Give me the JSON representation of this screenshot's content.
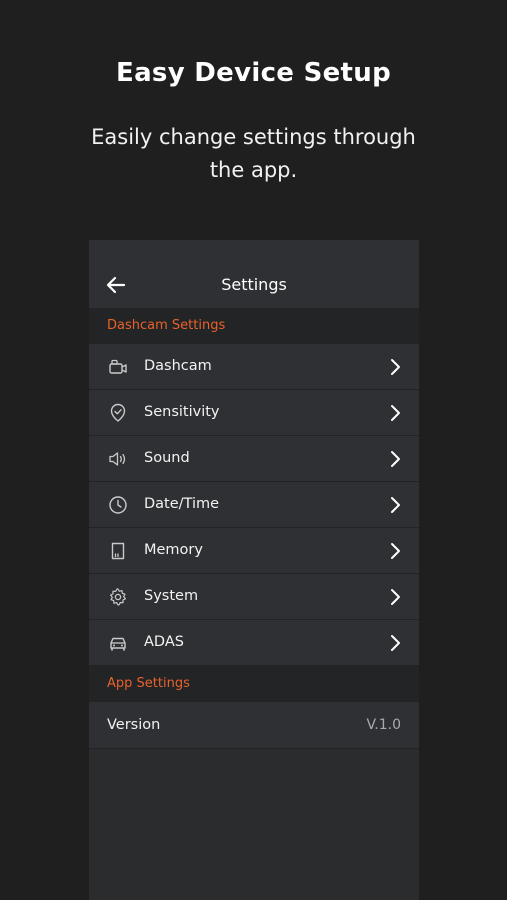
{
  "hero": {
    "title": "Easy Device Setup",
    "subtitle": "Easily change settings through the app."
  },
  "appbar": {
    "title": "Settings",
    "back_icon": "arrow-left-icon"
  },
  "sections": {
    "dashcam": "Dashcam Settings",
    "app": "App Settings"
  },
  "items": [
    {
      "label": "Dashcam",
      "icon": "camera-icon"
    },
    {
      "label": "Sensitivity",
      "icon": "shield-check-icon"
    },
    {
      "label": "Sound",
      "icon": "speaker-icon"
    },
    {
      "label": "Date/Time",
      "icon": "clock-icon"
    },
    {
      "label": "Memory",
      "icon": "sd-card-icon"
    },
    {
      "label": "System",
      "icon": "gear-icon"
    },
    {
      "label": "ADAS",
      "icon": "car-icon"
    }
  ],
  "version": {
    "label": "Version",
    "value": "V.1.0"
  },
  "colors": {
    "background": "#1f1f20",
    "panel": "#2f3033",
    "section_bg": "#232426",
    "accent": "#e8622c"
  }
}
